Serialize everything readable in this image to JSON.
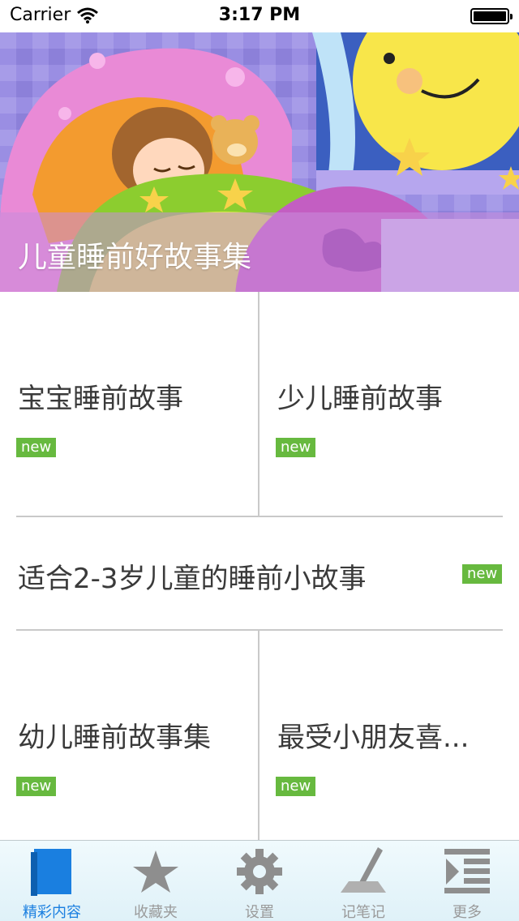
{
  "status_bar": {
    "carrier": "Carrier",
    "time": "3:17 PM"
  },
  "banner": {
    "title": "儿童睡前好故事集"
  },
  "stories": [
    {
      "title": "宝宝睡前故事",
      "badge": "new"
    },
    {
      "title": "少儿睡前故事",
      "badge": "new"
    },
    {
      "title": "适合2-3岁儿童的睡前小故事",
      "badge": "new"
    },
    {
      "title": "幼儿睡前故事集",
      "badge": "new"
    },
    {
      "title": "最受小朋友喜...",
      "badge": "new"
    }
  ],
  "tab_bar": {
    "tabs": [
      {
        "label": "精彩内容",
        "icon": "book-icon",
        "active": true
      },
      {
        "label": "收藏夹",
        "icon": "star-icon",
        "active": false
      },
      {
        "label": "设置",
        "icon": "gear-icon",
        "active": false
      },
      {
        "label": "记笔记",
        "icon": "pen-icon",
        "active": false
      },
      {
        "label": "更多",
        "icon": "list-icon",
        "active": false
      }
    ]
  },
  "colors": {
    "badge": "#67b93f",
    "active_tab": "#1a7fe0",
    "inactive_tab": "#9a9a9a"
  }
}
